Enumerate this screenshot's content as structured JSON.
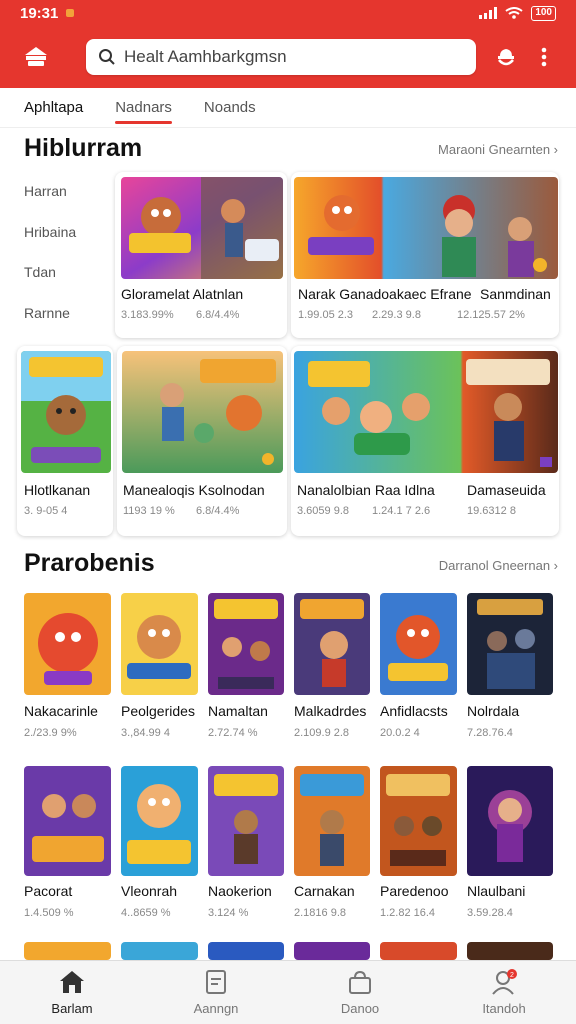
{
  "status_bar": {
    "time": "19:31",
    "battery": "100"
  },
  "search": {
    "placeholder": "Healt Aamhbarkgmsn"
  },
  "tabs": [
    "Aphltapa",
    "Nadnars",
    "Noands"
  ],
  "section1": {
    "title": "Hiblurram",
    "more": "Maraoni Gnearnten ›",
    "categories": [
      "Harran",
      "Hribaina",
      "Tdan",
      "Rarnne"
    ],
    "cards": [
      {
        "title": "Gloramelat Alatnlan",
        "meta": [
          "3.183.99%",
          "6.8/4.4%"
        ]
      },
      {
        "title": "Narak Ganadoakaec Efrane",
        "meta": [
          "1.99.05 2.3",
          "2.29.3 9.8"
        ]
      },
      {
        "title": "Sanmdinan",
        "meta": [
          "12.125.57 2%"
        ]
      },
      {
        "title": "Hlotlkanan",
        "meta": [
          "3. 9-05 4"
        ]
      },
      {
        "title": "Manealoqis Ksolnodan",
        "meta": [
          "1193 19 %",
          "6.8/4.4%"
        ]
      },
      {
        "title": "Nanalolbian Raa Idlna",
        "meta": [
          "3.6059 9.8",
          "1.24.1 7 2.6"
        ]
      },
      {
        "title": "Damaseuida",
        "meta": [
          "19.6312 8"
        ]
      }
    ]
  },
  "section2": {
    "title": "Prarobenis",
    "more": "Darranol Gneernan ›",
    "rows": [
      [
        {
          "title": "Nakacarinle",
          "meta": "2./23.9 9%"
        },
        {
          "title": "Peolgerides",
          "meta": "3.,84.99 4"
        },
        {
          "title": "Namaltan",
          "meta": "2.72.74 %"
        },
        {
          "title": "Malkadrdes",
          "meta": "2.109.9 2.8"
        },
        {
          "title": "Anfidlacsts",
          "meta": "20.0.2 4"
        },
        {
          "title": "Nolrdala",
          "meta": "7.28.76.4"
        }
      ],
      [
        {
          "title": "Pacorat",
          "meta": "1.4.509 %"
        },
        {
          "title": "Vleonrah",
          "meta": "4..8659 %"
        },
        {
          "title": "Naokerion",
          "meta": "3.124 %"
        },
        {
          "title": "Carnakan",
          "meta": "2.1816 9.8"
        },
        {
          "title": "Paredenoo",
          "meta": "1.2.82 16.4"
        },
        {
          "title": "Nlaulbani",
          "meta": "3.59.28.4"
        }
      ]
    ]
  },
  "bottom_nav": [
    "Barlam",
    "Aanngn",
    "Danoo",
    "Itandoh"
  ],
  "badge_count": "2",
  "colors": {
    "accent": "#e5362e"
  }
}
